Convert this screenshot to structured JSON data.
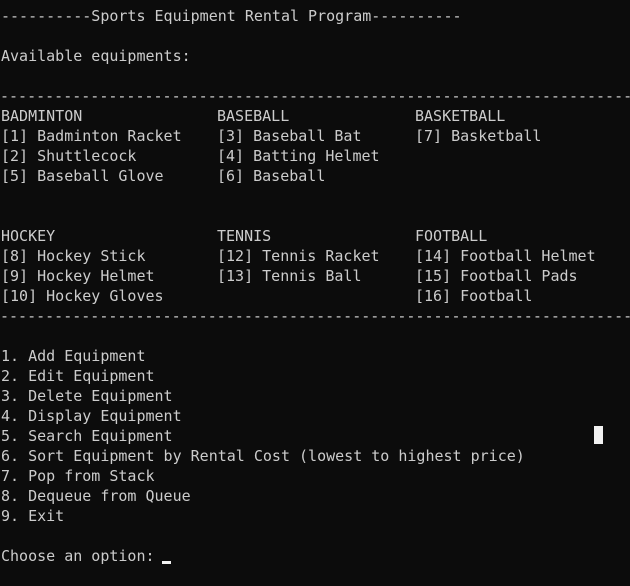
{
  "header": {
    "title": "----------Sports Equipment Rental Program----------"
  },
  "available_label": "Available equipments:",
  "divider_text": "--------------------------------------------------------------------------------",
  "categories_row1": [
    {
      "name": "BADMINTON",
      "items": [
        "[1] Badminton Racket",
        "[2] Shuttlecock",
        "[5] Baseball Glove"
      ]
    },
    {
      "name": "BASEBALL",
      "items": [
        "[3] Baseball Bat",
        "[4] Batting Helmet",
        "[6] Baseball"
      ]
    },
    {
      "name": "BASKETBALL",
      "items": [
        "[7] Basketball",
        "",
        ""
      ]
    }
  ],
  "categories_row2": [
    {
      "name": "HOCKEY",
      "items": [
        "[8] Hockey Stick",
        "[9] Hockey Helmet",
        "[10] Hockey Gloves"
      ]
    },
    {
      "name": "TENNIS",
      "items": [
        "[12] Tennis Racket",
        "[13] Tennis Ball",
        ""
      ]
    },
    {
      "name": "FOOTBALL",
      "items": [
        "[14] Football Helmet",
        "[15] Football Pads",
        "[16] Football"
      ]
    }
  ],
  "menu": [
    "1. Add Equipment",
    "2. Edit Equipment",
    "3. Delete Equipment",
    "4. Display Equipment",
    "5. Search Equipment",
    "6. Sort Equipment by Rental Cost (lowest to highest price)",
    "7. Pop from Stack",
    "8. Dequeue from Queue",
    "9. Exit"
  ],
  "prompt": "Choose an option: "
}
